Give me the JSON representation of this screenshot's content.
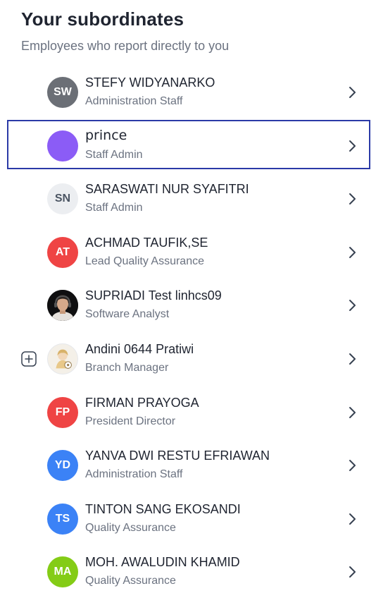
{
  "header": {
    "title": "Your subordinates",
    "subtitle": "Employees who report directly to you"
  },
  "employees": [
    {
      "name": "STEFY WIDYANARKO",
      "role": "Administration Staff",
      "initials": "SW",
      "color": "#6b6f76",
      "initials_color": "#ffffff",
      "avatar_type": "initials"
    },
    {
      "name": "prince",
      "role": "Staff Admin",
      "initials": "",
      "color": "#8b5cf6",
      "initials_color": "#ffffff",
      "avatar_type": "solid",
      "selected": true
    },
    {
      "name": "SARASWATI NUR SYAFITRI",
      "role": "Staff Admin",
      "initials": "SN",
      "color": "#eceef1",
      "initials_color": "#4b5563",
      "avatar_type": "initials"
    },
    {
      "name": "ACHMAD TAUFIK,SE",
      "role": "Lead Quality Assurance",
      "initials": "AT",
      "color": "#ef4444",
      "initials_color": "#ffffff",
      "avatar_type": "initials"
    },
    {
      "name": "SUPRIADI Test linhcs09",
      "role": "Software Analyst",
      "initials": "",
      "color": "#111111",
      "initials_color": "#ffffff",
      "avatar_type": "photo-headset"
    },
    {
      "name": "Andini 0644 Pratiwi",
      "role": "Branch Manager",
      "initials": "",
      "color": "#f3efe6",
      "initials_color": "#ffffff",
      "avatar_type": "illustration",
      "expandable": true
    },
    {
      "name": "FIRMAN PRAYOGA",
      "role": "President Director",
      "initials": "FP",
      "color": "#ef4444",
      "initials_color": "#ffffff",
      "avatar_type": "initials"
    },
    {
      "name": "YANVA DWI RESTU EFRIAWAN",
      "role": "Administration Staff",
      "initials": "YD",
      "color": "#3b82f6",
      "initials_color": "#ffffff",
      "avatar_type": "initials"
    },
    {
      "name": "TINTON SANG EKOSANDI",
      "role": "Quality Assurance",
      "initials": "TS",
      "color": "#3b82f6",
      "initials_color": "#ffffff",
      "avatar_type": "initials"
    },
    {
      "name": "MOH. AWALUDIN KHAMID",
      "role": "Quality Assurance",
      "initials": "MA",
      "color": "#84cc16",
      "initials_color": "#ffffff",
      "avatar_type": "initials"
    }
  ],
  "icons": {
    "row_action": "chevron-right-icon",
    "expand": "plus-square-icon"
  }
}
